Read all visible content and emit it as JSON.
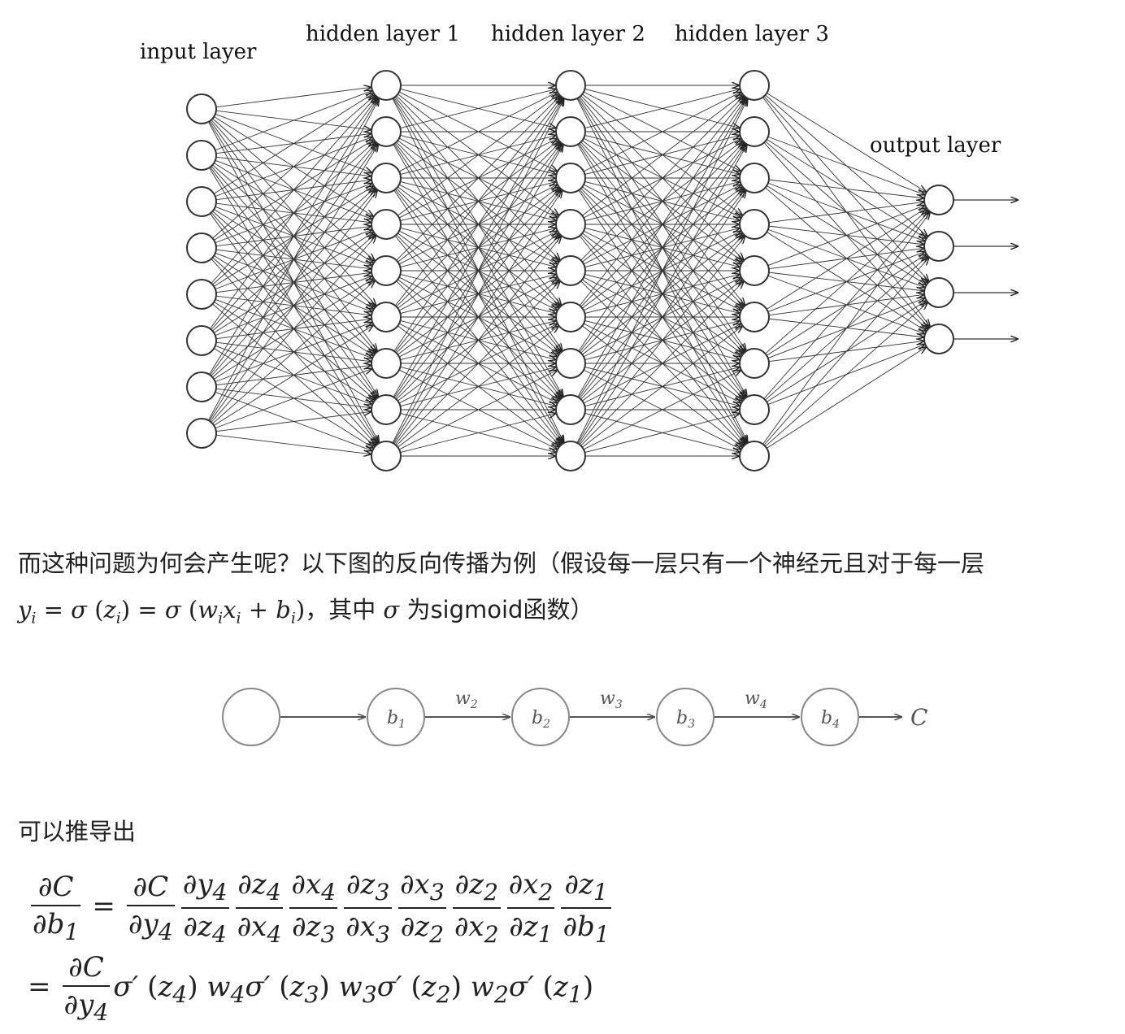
{
  "network": {
    "labels": {
      "input": "input layer",
      "hidden1": "hidden layer 1",
      "hidden2": "hidden layer 2",
      "hidden3": "hidden layer 3",
      "output": "output layer"
    },
    "layer_sizes": [
      8,
      9,
      9,
      9,
      4
    ]
  },
  "text": {
    "para1": "而这种问题为何会产生呢？以下图的反向传播为例（假设每一层只有一个神经元且对于每一层",
    "para2_suffix_a": "，其中",
    "para2_suffix_b": "为sigmoid函数）",
    "para3": "可以推导出"
  },
  "chain": {
    "nodes": [
      "",
      "b1",
      "b2",
      "b3",
      "b4"
    ],
    "weights": [
      "w2",
      "w3",
      "w4"
    ],
    "end_label": "C"
  }
}
